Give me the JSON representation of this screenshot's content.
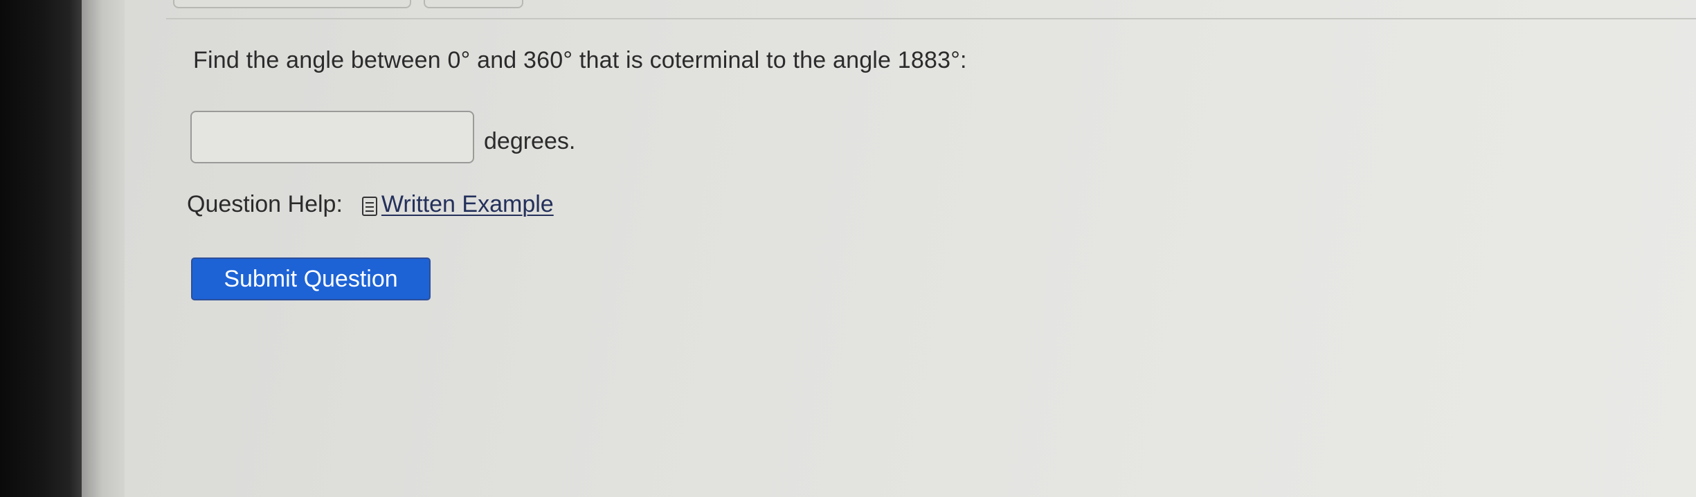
{
  "question": {
    "text": "Find the angle between 0° and 360° that is coterminal to the angle 1883°:"
  },
  "answer": {
    "value": "",
    "units": "degrees."
  },
  "help": {
    "label": "Question Help:",
    "icon": "document-icon",
    "link_label": "Written Example"
  },
  "actions": {
    "submit_label": "Submit Question"
  },
  "colors": {
    "button": "#1d63d6",
    "link": "#23305a",
    "text": "#2b2b2b"
  }
}
